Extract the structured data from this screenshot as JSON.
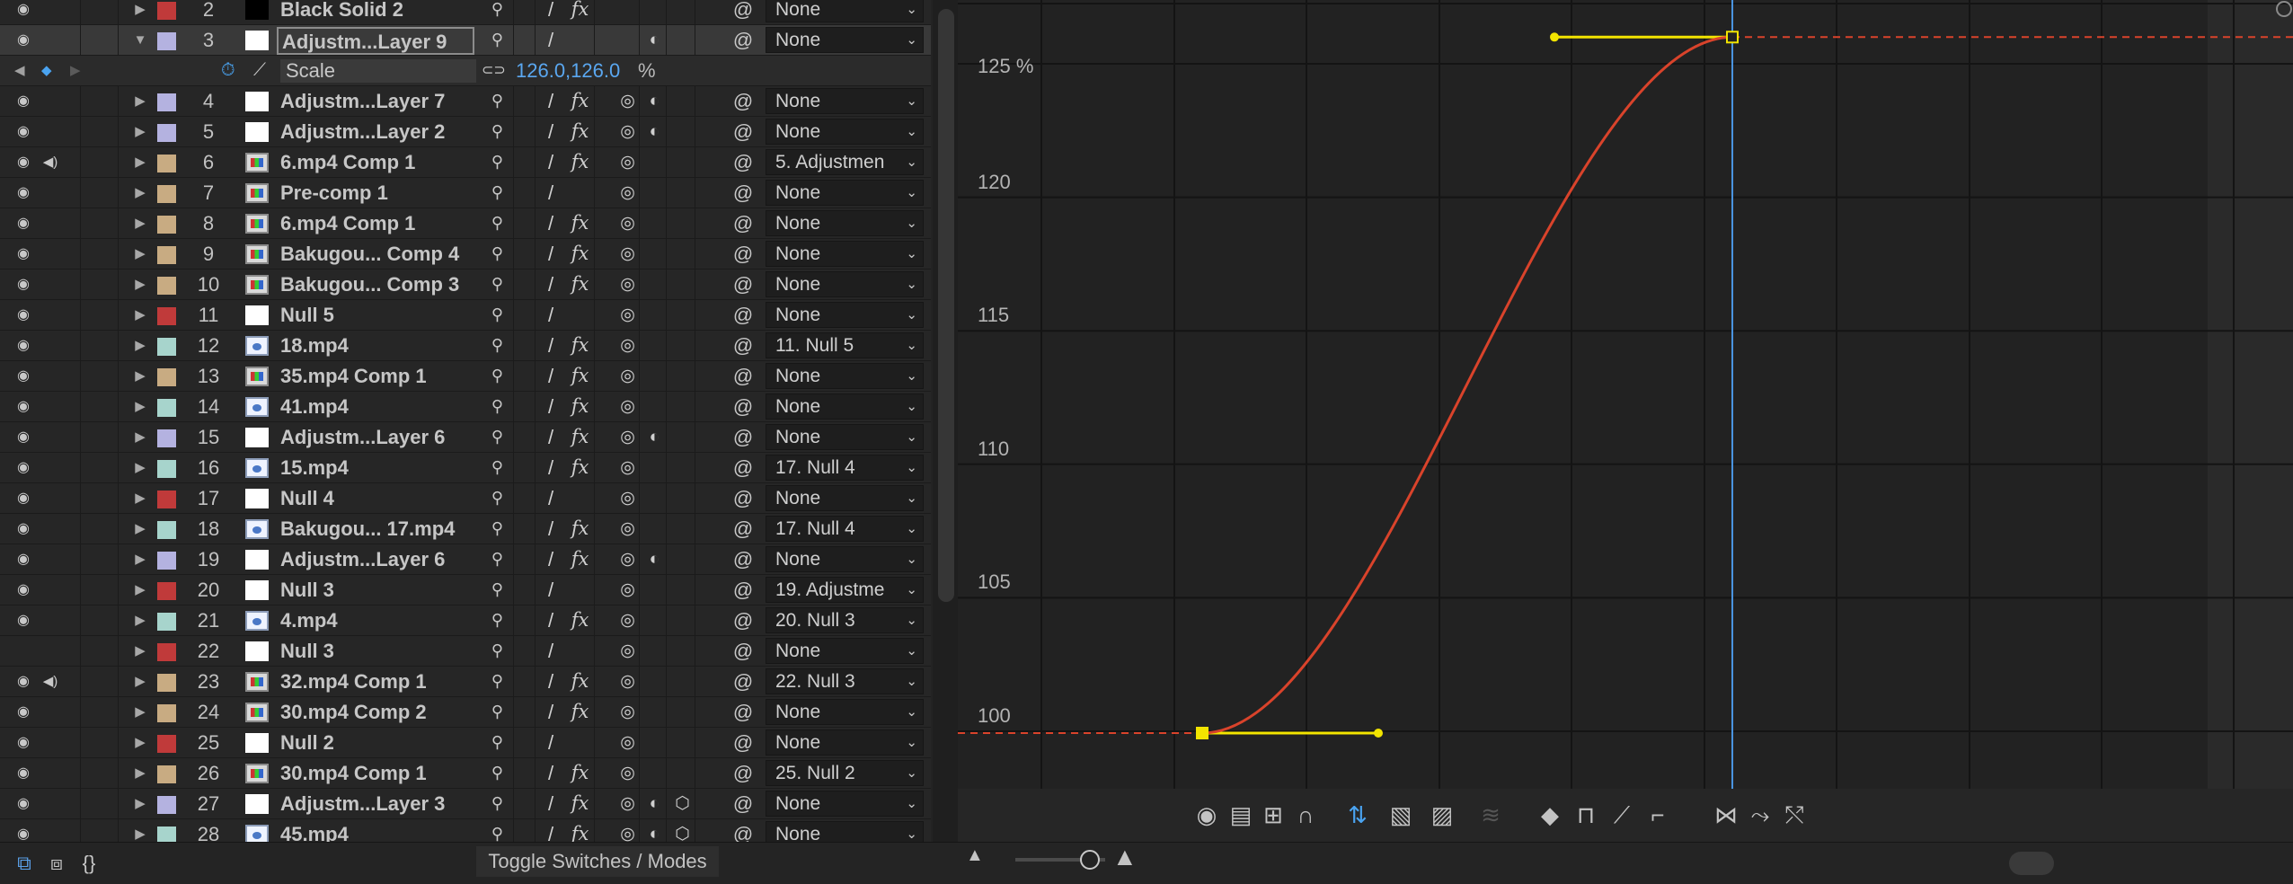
{
  "layers": [
    {
      "num": "2",
      "name": "Black Solid 2",
      "label_color": "#c03a3a",
      "src": "black",
      "eye": true,
      "audio": false,
      "twirl": "▶",
      "sw_blur": true,
      "fx": true,
      "motion_blur": false,
      "adj": false,
      "threeD": false,
      "parent": "None",
      "selected": false
    },
    {
      "num": "3",
      "name": "Adjustm...Layer 9",
      "label_color": "#b4b2e0",
      "src": "solid",
      "eye": true,
      "audio": false,
      "twirl": "▼",
      "sw_blur": false,
      "fx": false,
      "motion_blur": false,
      "adj": true,
      "threeD": false,
      "parent": "None",
      "selected": true,
      "editing": true
    },
    {
      "num": "4",
      "name": "Adjustm...Layer 7",
      "label_color": "#b4b2e0",
      "src": "solid",
      "eye": true,
      "audio": false,
      "twirl": "▶",
      "sw_blur": true,
      "fx": true,
      "motion_blur": true,
      "adj": true,
      "threeD": false,
      "parent": "None"
    },
    {
      "num": "5",
      "name": "Adjustm...Layer 2",
      "label_color": "#b4b2e0",
      "src": "solid",
      "eye": true,
      "audio": false,
      "twirl": "▶",
      "sw_blur": true,
      "fx": true,
      "motion_blur": true,
      "adj": true,
      "threeD": false,
      "parent": "None"
    },
    {
      "num": "6",
      "name": "6.mp4 Comp 1",
      "label_color": "#c8ab82",
      "src": "comp",
      "eye": true,
      "audio": true,
      "twirl": "▶",
      "sw_blur": true,
      "fx": true,
      "motion_blur": true,
      "adj": false,
      "threeD": false,
      "parent": "5. Adjustmen"
    },
    {
      "num": "7",
      "name": "Pre-comp 1",
      "label_color": "#c8ab82",
      "src": "comp",
      "eye": true,
      "audio": false,
      "twirl": "▶",
      "sw_blur": true,
      "fx": false,
      "motion_blur": true,
      "adj": false,
      "threeD": false,
      "parent": "None"
    },
    {
      "num": "8",
      "name": "6.mp4 Comp 1",
      "label_color": "#c8ab82",
      "src": "comp",
      "eye": true,
      "audio": false,
      "twirl": "▶",
      "sw_blur": true,
      "fx": true,
      "motion_blur": true,
      "adj": false,
      "threeD": false,
      "parent": "None"
    },
    {
      "num": "9",
      "name": "Bakugou... Comp 4",
      "label_color": "#c8ab82",
      "src": "comp",
      "eye": true,
      "audio": false,
      "twirl": "▶",
      "sw_blur": true,
      "fx": true,
      "motion_blur": true,
      "adj": false,
      "threeD": false,
      "parent": "None"
    },
    {
      "num": "10",
      "name": "Bakugou... Comp 3",
      "label_color": "#c8ab82",
      "src": "comp",
      "eye": true,
      "audio": false,
      "twirl": "▶",
      "sw_blur": true,
      "fx": true,
      "motion_blur": true,
      "adj": false,
      "threeD": false,
      "parent": "None"
    },
    {
      "num": "11",
      "name": "Null 5",
      "label_color": "#c03a3a",
      "src": "solid",
      "eye": true,
      "audio": false,
      "twirl": "▶",
      "sw_blur": true,
      "fx": false,
      "motion_blur": true,
      "adj": false,
      "threeD": false,
      "parent": "None"
    },
    {
      "num": "12",
      "name": "18.mp4",
      "label_color": "#a7d4cc",
      "src": "file",
      "eye": true,
      "audio": false,
      "twirl": "▶",
      "sw_blur": true,
      "fx": true,
      "motion_blur": true,
      "adj": false,
      "threeD": false,
      "parent": "11. Null 5"
    },
    {
      "num": "13",
      "name": "35.mp4 Comp 1",
      "label_color": "#c8ab82",
      "src": "comp",
      "eye": true,
      "audio": false,
      "twirl": "▶",
      "sw_blur": true,
      "fx": true,
      "motion_blur": true,
      "adj": false,
      "threeD": false,
      "parent": "None"
    },
    {
      "num": "14",
      "name": "41.mp4",
      "label_color": "#a7d4cc",
      "src": "file",
      "eye": true,
      "audio": false,
      "twirl": "▶",
      "sw_blur": true,
      "fx": true,
      "motion_blur": true,
      "adj": false,
      "threeD": false,
      "parent": "None"
    },
    {
      "num": "15",
      "name": "Adjustm...Layer 6",
      "label_color": "#b4b2e0",
      "src": "solid",
      "eye": true,
      "audio": false,
      "twirl": "▶",
      "sw_blur": true,
      "fx": true,
      "motion_blur": true,
      "adj": true,
      "threeD": false,
      "parent": "None"
    },
    {
      "num": "16",
      "name": "15.mp4",
      "label_color": "#a7d4cc",
      "src": "file",
      "eye": true,
      "audio": false,
      "twirl": "▶",
      "sw_blur": true,
      "fx": true,
      "motion_blur": true,
      "adj": false,
      "threeD": false,
      "parent": "17. Null 4"
    },
    {
      "num": "17",
      "name": "Null 4",
      "label_color": "#c03a3a",
      "src": "solid",
      "eye": true,
      "audio": false,
      "twirl": "▶",
      "sw_blur": true,
      "fx": false,
      "motion_blur": true,
      "adj": false,
      "threeD": false,
      "parent": "None"
    },
    {
      "num": "18",
      "name": "Bakugou... 17.mp4",
      "label_color": "#a7d4cc",
      "src": "file",
      "eye": true,
      "audio": false,
      "twirl": "▶",
      "sw_blur": true,
      "fx": true,
      "motion_blur": true,
      "adj": false,
      "threeD": false,
      "parent": "17. Null 4"
    },
    {
      "num": "19",
      "name": "Adjustm...Layer 6",
      "label_color": "#b4b2e0",
      "src": "solid",
      "eye": true,
      "audio": false,
      "twirl": "▶",
      "sw_blur": true,
      "fx": true,
      "motion_blur": true,
      "adj": true,
      "threeD": false,
      "parent": "None"
    },
    {
      "num": "20",
      "name": "Null 3",
      "label_color": "#c03a3a",
      "src": "solid",
      "eye": true,
      "audio": false,
      "twirl": "▶",
      "sw_blur": true,
      "fx": false,
      "motion_blur": true,
      "adj": false,
      "threeD": false,
      "parent": "19. Adjustme"
    },
    {
      "num": "21",
      "name": "4.mp4",
      "label_color": "#a7d4cc",
      "src": "file",
      "eye": true,
      "audio": false,
      "twirl": "▶",
      "sw_blur": true,
      "fx": true,
      "motion_blur": true,
      "adj": false,
      "threeD": false,
      "parent": "20. Null 3"
    },
    {
      "num": "22",
      "name": "Null 3",
      "label_color": "#c03a3a",
      "src": "solid",
      "eye": false,
      "audio": false,
      "twirl": "▶",
      "sw_blur": true,
      "fx": false,
      "motion_blur": true,
      "adj": false,
      "threeD": false,
      "parent": "None"
    },
    {
      "num": "23",
      "name": "32.mp4 Comp 1",
      "label_color": "#c8ab82",
      "src": "comp",
      "eye": true,
      "audio": true,
      "twirl": "▶",
      "sw_blur": true,
      "fx": true,
      "motion_blur": true,
      "adj": false,
      "threeD": false,
      "parent": "22. Null 3"
    },
    {
      "num": "24",
      "name": "30.mp4 Comp 2",
      "label_color": "#c8ab82",
      "src": "comp",
      "eye": true,
      "audio": false,
      "twirl": "▶",
      "sw_blur": true,
      "fx": true,
      "motion_blur": true,
      "adj": false,
      "threeD": false,
      "parent": "None"
    },
    {
      "num": "25",
      "name": "Null 2",
      "label_color": "#c03a3a",
      "src": "solid",
      "eye": true,
      "audio": false,
      "twirl": "▶",
      "sw_blur": true,
      "fx": false,
      "motion_blur": true,
      "adj": false,
      "threeD": false,
      "parent": "None"
    },
    {
      "num": "26",
      "name": "30.mp4 Comp 1",
      "label_color": "#c8ab82",
      "src": "comp",
      "eye": true,
      "audio": false,
      "twirl": "▶",
      "sw_blur": true,
      "fx": true,
      "motion_blur": true,
      "adj": false,
      "threeD": false,
      "parent": "25. Null 2"
    },
    {
      "num": "27",
      "name": "Adjustm...Layer 3",
      "label_color": "#b4b2e0",
      "src": "solid",
      "eye": true,
      "audio": false,
      "twirl": "▶",
      "sw_blur": true,
      "fx": true,
      "motion_blur": true,
      "adj": true,
      "threeD": true,
      "parent": "None"
    },
    {
      "num": "28",
      "name": "45.mp4",
      "label_color": "#a7d4cc",
      "src": "file",
      "eye": true,
      "audio": false,
      "twirl": "▶",
      "sw_blur": true,
      "fx": true,
      "motion_blur": true,
      "adj": true,
      "threeD": true,
      "parent": "None"
    }
  ],
  "property": {
    "name": "Scale",
    "value": "126.0,126.0",
    "unit": "%"
  },
  "graph": {
    "y_ticks": [
      {
        "label": "125 %",
        "value": 125
      },
      {
        "label": "120",
        "value": 120
      },
      {
        "label": "115",
        "value": 115
      },
      {
        "label": "110",
        "value": 110
      },
      {
        "label": "105",
        "value": 105
      },
      {
        "label": "100",
        "value": 100
      }
    ],
    "curve_color": "#d9432b",
    "handle_color": "#f2e400",
    "playhead_color": "#4a94e0",
    "keyframe_start_value": 100,
    "keyframe_end_value": 126
  },
  "graph_toolbar": {
    "icons": [
      "eye-icon",
      "graph-type-icon",
      "transform-box-icon",
      "snap-icon",
      "auto-zoom-height-icon",
      "fit-selection-icon",
      "fit-all-icon",
      "separate-dimensions-icon",
      "edit-keyframe-icon",
      "hold-keyframe-icon",
      "linear-keyframe-icon",
      "auto-bezier-icon",
      "easy-ease-icon",
      "easy-ease-in-icon",
      "easy-ease-out-icon"
    ]
  },
  "bottom_bar": {
    "toggle_label": "Toggle Switches / Modes"
  }
}
